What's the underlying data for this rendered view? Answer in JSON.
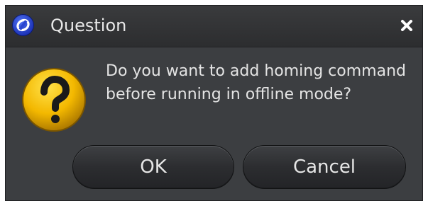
{
  "window": {
    "title": "Question",
    "close_glyph": "✖"
  },
  "icons": {
    "app": "app-logo-icon",
    "message": "question-mark-icon",
    "close": "close-icon"
  },
  "message": {
    "text": "Do you want to add homing command before running in offline mode?"
  },
  "buttons": {
    "ok_label": "OK",
    "cancel_label": "Cancel"
  },
  "colors": {
    "background": "#3c3e41",
    "titlebar": "#2c2d2f",
    "text": "#e4e4e4",
    "question_icon": "#f0b400",
    "app_icon": "#2a45d0"
  }
}
